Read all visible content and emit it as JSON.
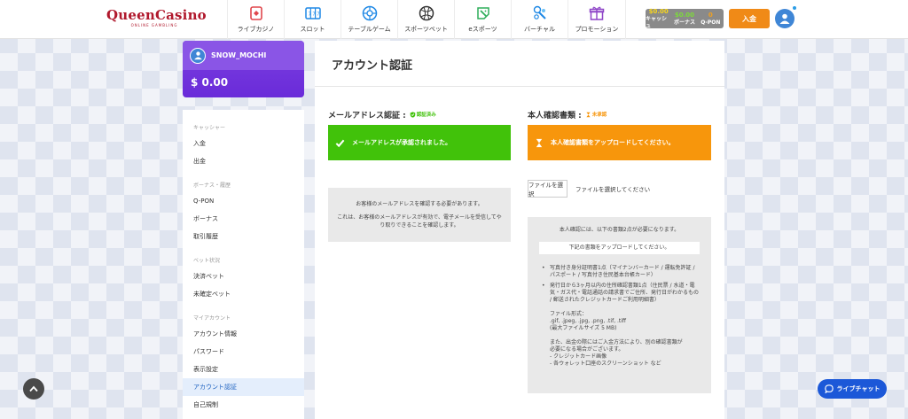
{
  "brand": {
    "name": "QueenCasino",
    "tagline": "ONLINE GAMBLING"
  },
  "nav": [
    {
      "label": "ライブカジノ",
      "icon": "live-casino-icon",
      "color": "#e0474c"
    },
    {
      "label": "スロット",
      "icon": "slot-icon",
      "color": "#1e88e5"
    },
    {
      "label": "テーブルゲーム",
      "icon": "table-game-icon",
      "color": "#1e88e5"
    },
    {
      "label": "スポーツベット",
      "icon": "sports-bet-icon",
      "color": "#333333"
    },
    {
      "label": "eスポーツ",
      "icon": "esports-icon",
      "color": "#2eae5a"
    },
    {
      "label": "バーチャル",
      "icon": "virtual-icon",
      "color": "#1e88e5"
    },
    {
      "label": "プロモーション",
      "icon": "promotion-icon",
      "color": "#8e44c7"
    }
  ],
  "balances": [
    {
      "value": "$0.00",
      "label": "キャッシュ",
      "color": "#f7d51d"
    },
    {
      "value": "$0.00",
      "label": "ボーナス",
      "color": "#7ddb3a"
    },
    {
      "value": "0",
      "label": "Q-PON",
      "color": "#f0a020"
    }
  ],
  "header": {
    "deposit_label": "入金"
  },
  "user": {
    "name": "SNOW_MOCHI",
    "balance": "$ 0.00"
  },
  "sidebar": {
    "groups": [
      {
        "title": "キャッシャー",
        "items": [
          "入金",
          "出金"
        ]
      },
      {
        "title": "ボーナス・履歴",
        "items": [
          "Q-PON",
          "ボーナス",
          "取引履歴"
        ]
      },
      {
        "title": "ベット状況",
        "items": [
          "決済ベット",
          "未確定ベット"
        ]
      },
      {
        "title": "マイアカウント",
        "items": [
          "アカウント情報",
          "パスワード",
          "表示設定",
          "アカウント認証",
          "自己規制"
        ]
      }
    ],
    "active_item": "アカウント認証"
  },
  "main": {
    "title": "アカウント認証",
    "email": {
      "title": "メールアドレス認証 :",
      "badge": "認証済み",
      "badge_color": "#41c20a",
      "alert": "メールアドレスが承認されました。",
      "info_line1": "お客様のメールアドレスを確認する必要があります。",
      "info_line2": "これは、お客様のメールアドレスが有効で、電子メールを受信してやり取りできることを確認します。"
    },
    "identity": {
      "title": "本人確認書類 :",
      "badge": "未承認",
      "badge_color": "#f7960c",
      "alert": "本人確認書類をアップロードしてください。",
      "file_button": "ファイルを選択",
      "file_status": "ファイルを選択してください",
      "doc_head": "本人確認には、以下の書類2点が必要になります。",
      "doc_notice": "下記の書類をアップロードしてください。",
      "doc_items": [
        "写真付き身分証明書1点（マイナンバーカード / 運転免許証 / パスポート / 写真付き住民基本台帳カード）",
        "発行日から3ヶ月以内の住所確認書類1点（住民票 / 水道・電気・ガス代・電話通話の請求書でご住所、発行日がわかるもの / 郵送されたクレジットカードご利用明細書）"
      ],
      "formats_label": "ファイル形式：",
      "formats": ".gif, .jpeg, .jpg, .png, .tif, .tiff",
      "max_size": "(最大ファイルサイズ 5 MB)",
      "extra_line1": "また、出金の際にはご入金方法により、別の確認書類が",
      "extra_line2": "必要になる場合がございます。",
      "extra_line3": "- クレジットカード画像",
      "extra_line4": "- 各ウォレット口座のスクリーンショット など"
    }
  },
  "floating": {
    "live_chat": "ライブチャット"
  }
}
